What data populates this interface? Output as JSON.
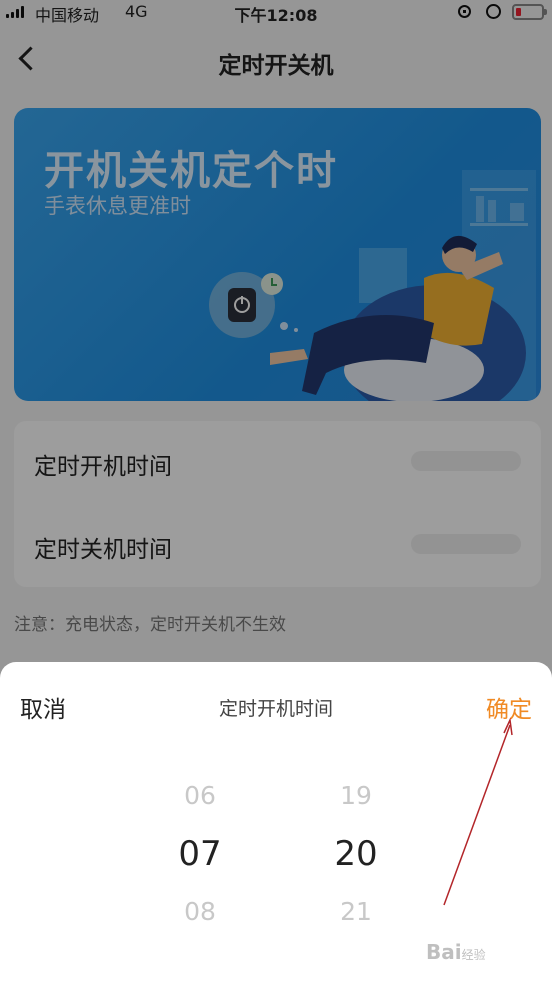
{
  "status_bar": {
    "carrier": "中国移动",
    "network": "4G",
    "time": "下午12:08",
    "icons": [
      "signal-icon",
      "rotation-lock-icon",
      "alarm-icon",
      "battery-icon"
    ],
    "battery_color": "#e23"
  },
  "nav": {
    "back_icon": "chevron-left-icon",
    "title": "定时开关机"
  },
  "banner": {
    "title": "开机关机定个时",
    "subtitle": "手表休息更准时"
  },
  "settings": {
    "power_on_label": "定时开机时间",
    "power_off_label": "定时关机时间",
    "note": "注意：充电状态，定时开关机不生效"
  },
  "picker_sheet": {
    "cancel_label": "取消",
    "title": "定时开机时间",
    "confirm_label": "确定",
    "confirm_color": "#f08a24",
    "hours": {
      "above": "06",
      "selected": "07",
      "below": "08"
    },
    "minutes": {
      "above": "19",
      "selected": "20",
      "below": "21"
    }
  },
  "watermark": {
    "text": "Bai",
    "suffix": "经验"
  }
}
